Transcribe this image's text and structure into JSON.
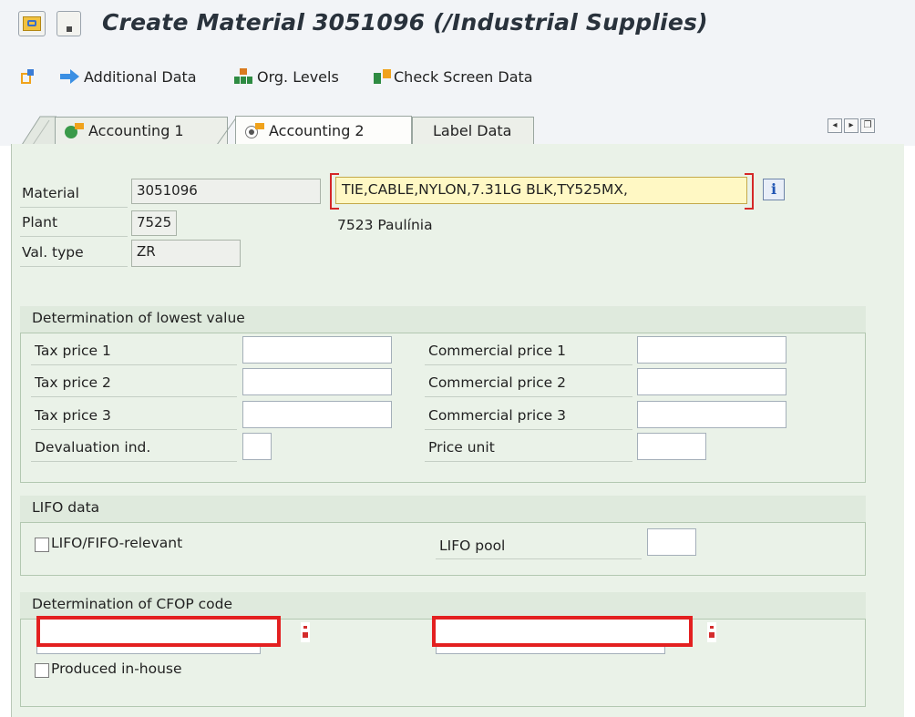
{
  "window": {
    "title": "Create Material 3051096 (/Industrial Supplies)"
  },
  "toolbar": {
    "additional_data": "Additional Data",
    "org_levels": "Org. Levels",
    "check_screen_data": "Check Screen Data"
  },
  "tabs": [
    {
      "label": "Accounting 1",
      "status": "complete"
    },
    {
      "label": "Accounting 2",
      "status": "active"
    },
    {
      "label": "Label Data",
      "status": "none"
    }
  ],
  "header": {
    "material_label": "Material",
    "material_value": "3051096",
    "material_description": "TIE,CABLE,NYLON,7.31LG BLK,TY525MX,",
    "plant_label": "Plant",
    "plant_value": "7525",
    "plant_description": "7523 Paulínia",
    "valtype_label": "Val. type",
    "valtype_value": "ZR"
  },
  "lowest_value": {
    "title": "Determination of lowest value",
    "tax_price_1": "Tax price 1",
    "tax_price_2": "Tax price 2",
    "tax_price_3": "Tax price 3",
    "devaluation_ind": "Devaluation ind.",
    "commercial_price_1": "Commercial price 1",
    "commercial_price_2": "Commercial price 2",
    "commercial_price_3": "Commercial price 3",
    "price_unit": "Price unit"
  },
  "lifo": {
    "title": "LIFO data",
    "lifo_fifo_relevant": "LIFO/FIFO-relevant",
    "lifo_fifo_checked": false,
    "lifo_pool": "LIFO pool"
  },
  "cfop": {
    "title": "Determination of CFOP code",
    "produced_in_house": "Produced in-house",
    "produced_in_house_checked": false
  },
  "colors": {
    "window_bg": "#f2f4f7",
    "content_bg": "#eaf2e8",
    "required_field": "#fff8c4",
    "redaction_border": "#e32020"
  }
}
